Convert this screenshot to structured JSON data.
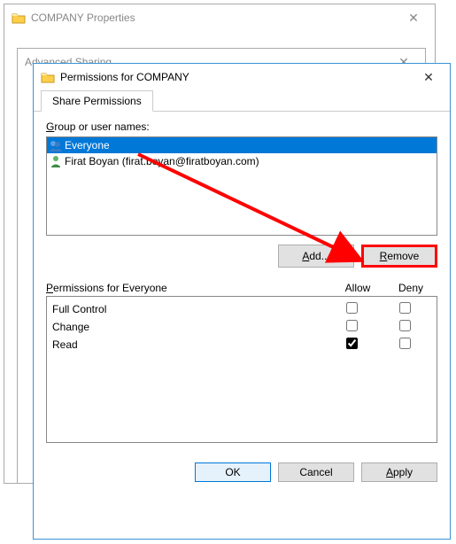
{
  "windows": {
    "properties": {
      "title": "COMPANY Properties"
    },
    "advanced": {
      "title": "Advanced Sharing"
    },
    "permissions": {
      "title": "Permissions for COMPANY",
      "tab": "Share Permissions",
      "group_label": "Group or user names:",
      "list": {
        "items": [
          {
            "name": "Everyone",
            "selected": true,
            "icon": "group"
          },
          {
            "name": "Firat Boyan (firat.boyan@firatboyan.com)",
            "selected": false,
            "icon": "user"
          }
        ]
      },
      "buttons": {
        "add": "Add...",
        "remove": "Remove"
      },
      "perm_header": "Permissions for Everyone",
      "allow": "Allow",
      "deny": "Deny",
      "perm_rows": [
        {
          "name": "Full Control",
          "allow": false,
          "deny": false
        },
        {
          "name": "Change",
          "allow": false,
          "deny": false
        },
        {
          "name": "Read",
          "allow": true,
          "deny": false
        }
      ],
      "bottom": {
        "ok": "OK",
        "cancel": "Cancel",
        "apply": "Apply"
      }
    }
  },
  "annotation": {
    "arrow_points_to": "remove-button"
  }
}
